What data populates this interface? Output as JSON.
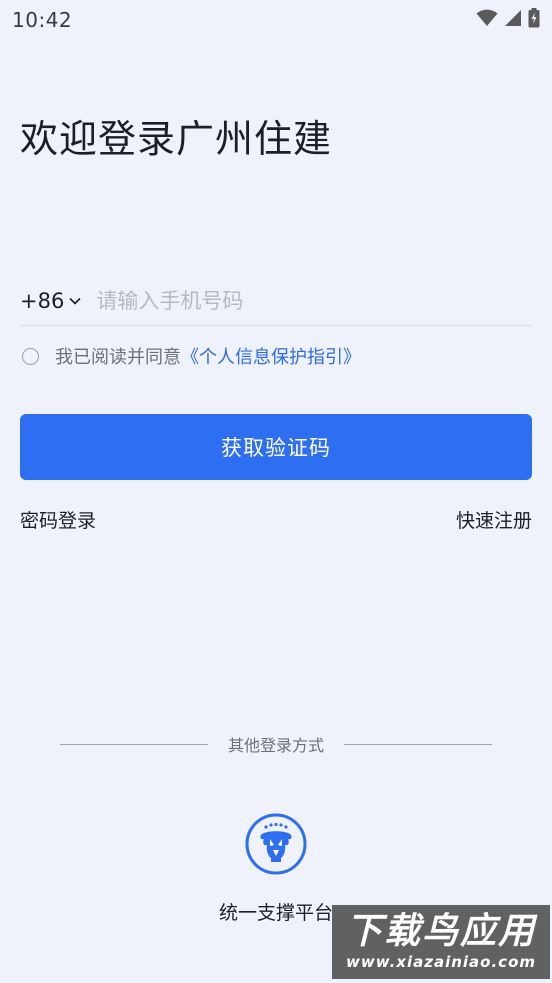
{
  "status_bar": {
    "time": "10:42",
    "icons": [
      "wifi-icon",
      "signal-icon",
      "battery-icon"
    ]
  },
  "page": {
    "title": "欢迎登录广州住建"
  },
  "phone": {
    "country_code": "+86",
    "placeholder": "请输入手机号码",
    "value": ""
  },
  "agreement": {
    "text": "我已阅读并同意",
    "link": "《个人信息保护指引》",
    "checked": false
  },
  "actions": {
    "get_code": "获取验证码",
    "password_login": "密码登录",
    "quick_register": "快速注册"
  },
  "other_login": {
    "heading": "其他登录方式",
    "unified_platform": "统一支撑平台",
    "icon": "unified-platform-logo-icon"
  },
  "watermark": {
    "main": "下载鸟应用",
    "sub": "www.xiazainiao.com"
  },
  "colors": {
    "background": "#eff2fb",
    "primary": "#2e6ef0",
    "link": "#2d6be8"
  }
}
